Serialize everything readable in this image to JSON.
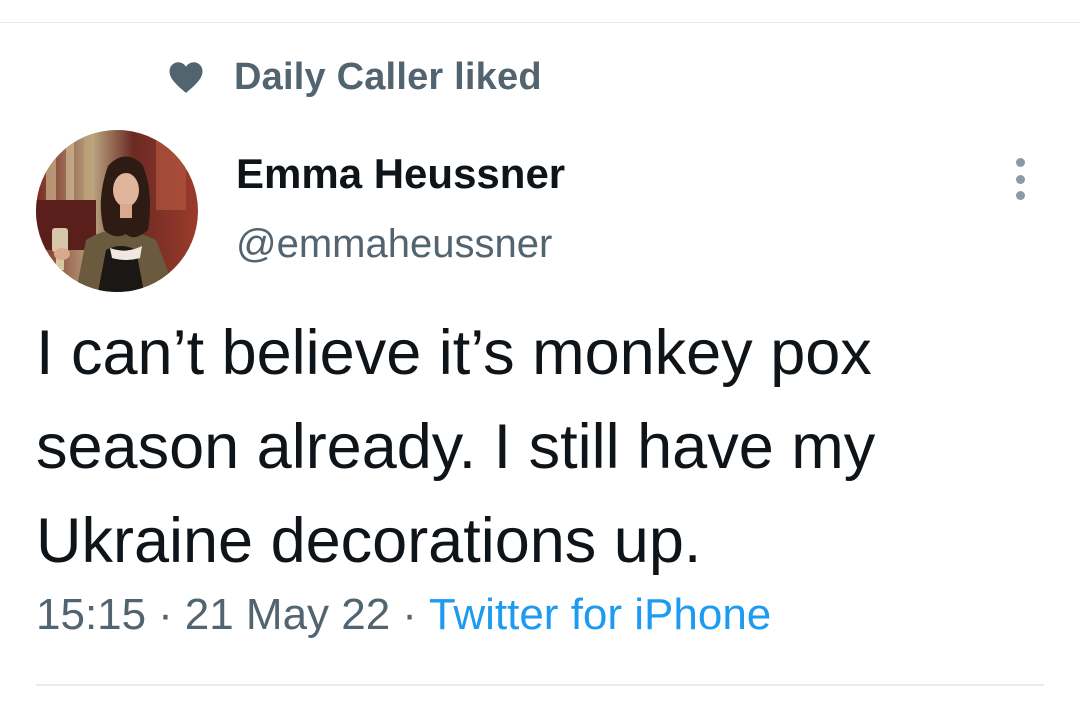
{
  "social_context": {
    "icon": "heart-icon",
    "text": "Daily Caller liked"
  },
  "author": {
    "display_name": "Emma Heussner",
    "handle": "@emmaheussner"
  },
  "tweet": {
    "text": "I can’t believe it’s monkey pox season already. I still have my Ukraine decorations up."
  },
  "meta": {
    "time": "15:15",
    "separator": "·",
    "date": "21 May 22",
    "source": "Twitter for iPhone"
  },
  "colors": {
    "primary_text": "#0f1419",
    "secondary_text": "#536471",
    "link": "#1d9bf0"
  }
}
